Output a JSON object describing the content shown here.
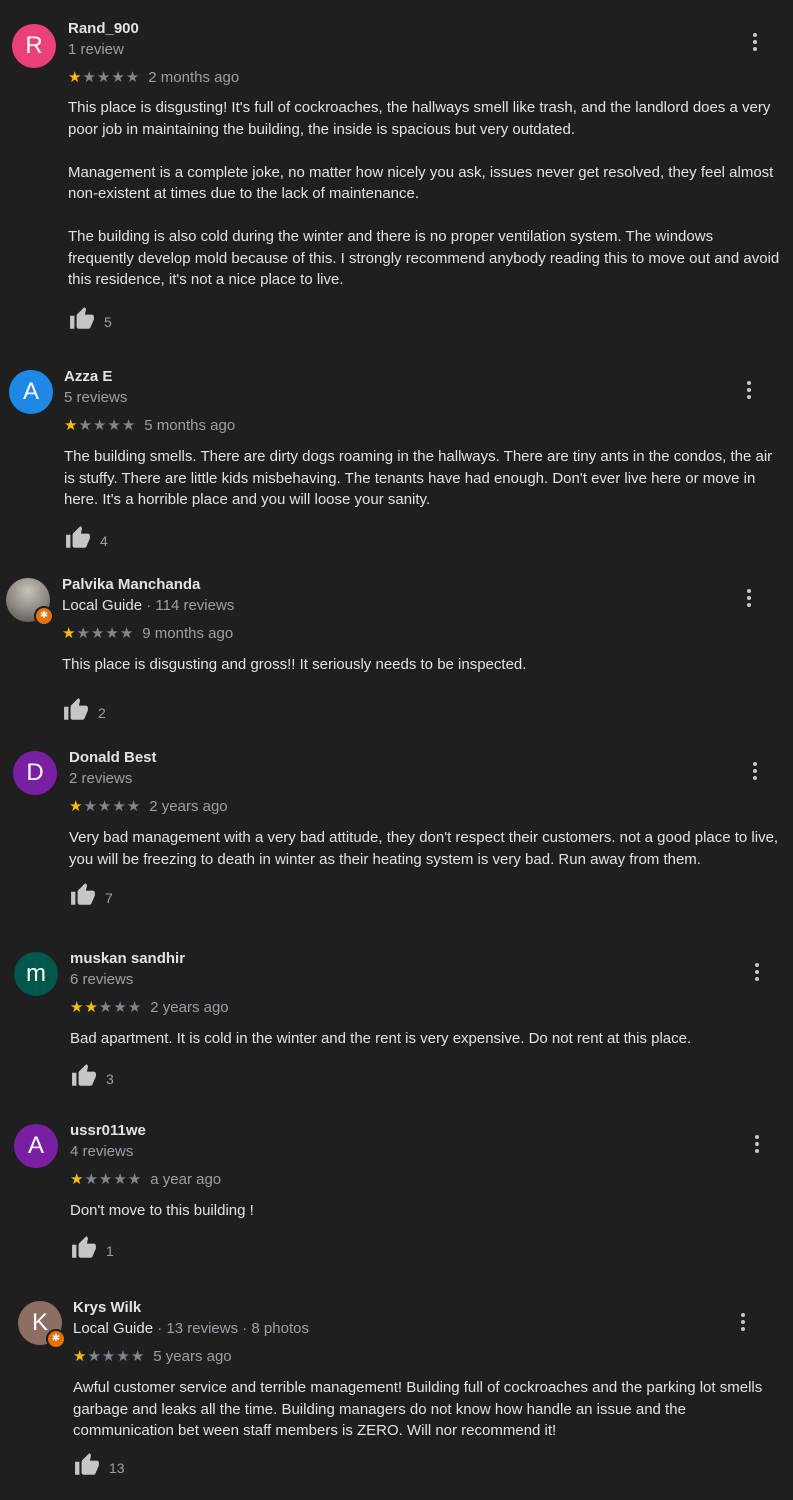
{
  "reviews": [
    {
      "initial": "R",
      "avatar_color": "#ec407a",
      "name": "Rand_900",
      "guide": "",
      "meta": "1 review",
      "stars": 1,
      "time": "2 months ago",
      "paragraphs": [
        "This place is disgusting! It's full of cockroaches, the hallways smell like trash, and the landlord does a very poor job in maintaining the building, the inside is spacious but very outdated.",
        "Management is a complete joke, no matter how nicely you ask, issues never get resolved, they feel almost non-existent at times due to the lack of maintenance.",
        "The building is also cold during the winter and there is no proper ventilation system. The windows frequently develop mold because of this. I strongly recommend anybody reading this to move out and avoid this residence, it's not a nice place to live."
      ],
      "likes": "5"
    },
    {
      "initial": "A",
      "avatar_color": "#1e88e5",
      "name": "Azza E",
      "guide": "",
      "meta": "5 reviews",
      "stars": 1,
      "time": "5 months ago",
      "paragraphs": [
        "The building smells.  There are dirty dogs roaming in the hallways.  There are tiny ants in the condos, the air is stuffy. There are little kids misbehaving. The tenants have had enough. Don't ever live here or move in here. It's a horrible place and you will loose your sanity."
      ],
      "likes": "4"
    },
    {
      "initial": "",
      "avatar_color": "#8a8580",
      "name": "Palvika Manchanda",
      "guide": "Local Guide",
      "meta": " · 114 reviews",
      "stars": 1,
      "time": "9 months ago",
      "paragraphs": [
        "This place is disgusting and gross!! It seriously needs to be inspected."
      ],
      "likes": "2"
    },
    {
      "initial": "D",
      "avatar_color": "#7b1fa2",
      "name": "Donald Best",
      "guide": "",
      "meta": "2 reviews",
      "stars": 1,
      "time": "2 years ago",
      "paragraphs": [
        "Very bad management with a very bad attitude, they don't respect their customers. not a good place to live, you will be freezing to death in winter as their heating system is very bad. Run away from them."
      ],
      "likes": "7"
    },
    {
      "initial": "m",
      "avatar_color": "#00574b",
      "name": "muskan sandhir",
      "guide": "",
      "meta": "6 reviews",
      "stars": 2,
      "time": "2 years ago",
      "paragraphs": [
        "Bad apartment. It is cold in the winter and the rent is very expensive. Do not rent at this place."
      ],
      "likes": "3"
    },
    {
      "initial": "A",
      "avatar_color": "#7b1fa2",
      "name": "ussr011we",
      "guide": "",
      "meta": "4 reviews",
      "stars": 1,
      "time": "a year ago",
      "paragraphs": [
        "Don't move to this building !"
      ],
      "likes": "1"
    },
    {
      "initial": "K",
      "avatar_color": "#8d6e63",
      "name": "Krys Wilk",
      "guide": "Local Guide",
      "meta": " · 13 reviews · 8 photos",
      "stars": 1,
      "time": "5 years ago",
      "paragraphs": [
        "Awful customer service and terrible management! Building full of cockroaches and the parking lot smells garbage and leaks all the time. Building managers do not know how handle an issue and the communication bet ween staff members is ZERO. Will nor recommend it!"
      ],
      "likes": "13"
    }
  ],
  "icons": {
    "like": "thumbs-up-icon",
    "more": "more-vert-icon",
    "guide": "local-guide-badge-icon"
  }
}
